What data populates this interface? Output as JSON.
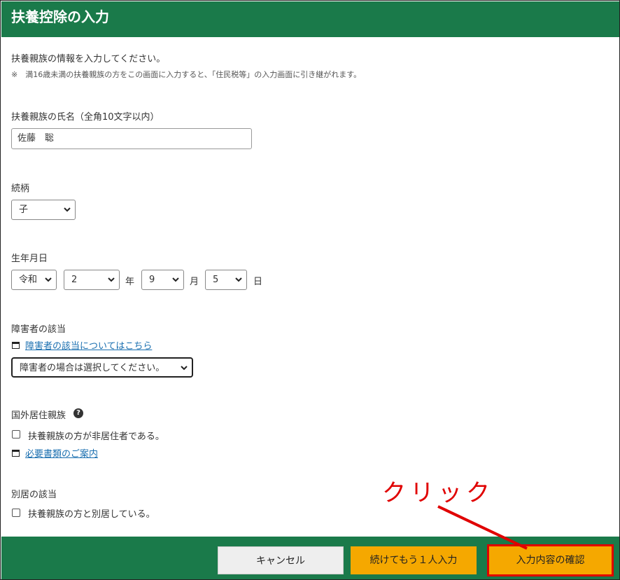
{
  "header": {
    "title": "扶養控除の入力"
  },
  "intro": {
    "text": "扶養親族の情報を入力してください。",
    "note": "※　満16歳未満の扶養親族の方をこの画面に入力すると、「住民税等」の入力画面に引き継がれます。"
  },
  "name_field": {
    "label": "扶養親族の氏名（全角10文字以内）",
    "value": "佐藤　聡"
  },
  "relation": {
    "label": "続柄",
    "value": "子"
  },
  "birthdate": {
    "label": "生年月日",
    "era": "令和",
    "year": "2",
    "year_unit": "年",
    "month": "9",
    "month_unit": "月",
    "day": "5",
    "day_unit": "日"
  },
  "disability": {
    "label": "障害者の該当",
    "link": "障害者の該当についてはこちら",
    "select_value": "障害者の場合は選択してください。"
  },
  "overseas": {
    "label": "国外居住親族",
    "help_icon": "?",
    "checkbox_label": "扶養親族の方が非居住者である。",
    "link": "必要書類のご案内"
  },
  "separate": {
    "label": "別居の該当",
    "checkbox_label": "扶養親族の方と別居している。"
  },
  "footer": {
    "cancel": "キャンセル",
    "add_more": "続けてもう１人入力",
    "confirm": "入力内容の確認"
  },
  "annotation": {
    "text": "クリック",
    "color": "#e00000"
  },
  "colors": {
    "header": "#1a7a4a",
    "button": "#f5a800",
    "link": "#1a6fb0"
  }
}
